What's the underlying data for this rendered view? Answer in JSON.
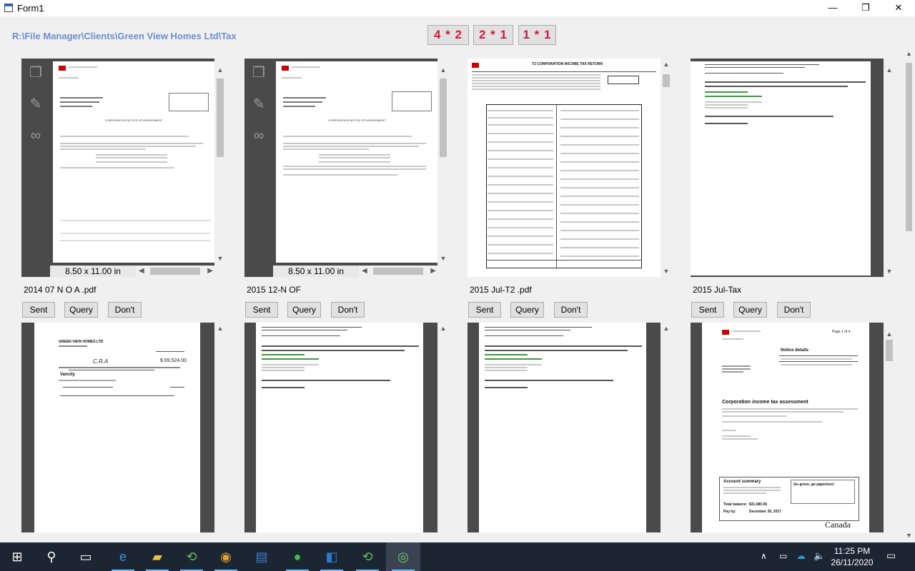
{
  "window": {
    "title": "Form1",
    "minimize": "—",
    "maximize": "❐",
    "close": "✕"
  },
  "path": "R:\\File Manager\\Clients\\Green View Homes Ltd\\Tax",
  "layout_buttons": [
    "4 * 2",
    "2 * 1",
    "1 * 1"
  ],
  "tiles": [
    {
      "filename": "2014 07 N O A .pdf",
      "size": "8.50 x 11.00 in"
    },
    {
      "filename": "2015 12-N OF",
      "size": "8.50 x 11.00 in"
    },
    {
      "filename": "2015 Jul-T2 .pdf"
    },
    {
      "filename": "2015 Jul-Tax"
    },
    {
      "filename": ""
    },
    {
      "filename": ""
    },
    {
      "filename": ""
    },
    {
      "filename": ""
    }
  ],
  "actions": {
    "sent": "Sent",
    "query": "Query",
    "dont": "Don't"
  },
  "icons": {
    "doc": "copy-icon",
    "attach": "paperclip-icon",
    "find": "binoculars-icon"
  },
  "doc_text": {
    "noa_title": "CORPORATION NOTICE OF ASSESSMENT",
    "t2_title": "T2 CORPORATION INCOME TAX RETURN",
    "assessment_title": "Corporation income tax assessment",
    "notice_details": "Notice details",
    "account_summary": "Account summary",
    "go_green": "Go green, go paperless!",
    "canada": "Canada",
    "cheque_payee": "C.R.A",
    "cheque_company": "GREEN VIEW HOMES LTD",
    "cheque_amount": "$ 69,524.00",
    "balance_label": "Total balance:",
    "balance_value": "$31,080.06",
    "payby_label": "Pay by:",
    "payby_value": "December 30, 2017",
    "page_of": "Page 1 of 4"
  },
  "taskbar": {
    "time": "11:25 PM",
    "date": "26/11/2020"
  }
}
